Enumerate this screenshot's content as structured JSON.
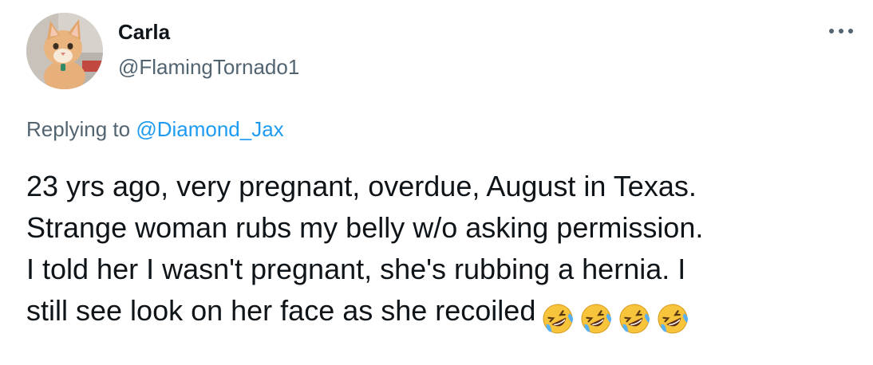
{
  "user": {
    "display_name": "Carla",
    "handle": "@FlamingTornado1"
  },
  "reply": {
    "prefix": "Replying to",
    "mention": "@Diamond_Jax"
  },
  "tweet": {
    "lines": [
      "23 yrs ago, very pregnant, overdue, August in Texas.",
      "Strange woman rubs my belly w/o asking permission.",
      "I told her I wasn't pregnant, she's rubbing a hernia. I",
      "still see look on her face as she recoiled"
    ],
    "emoji": [
      "rolling-on-floor-laughing-icon",
      "rolling-on-floor-laughing-icon",
      "rolling-on-floor-laughing-icon",
      "rolling-on-floor-laughing-icon"
    ]
  },
  "colors": {
    "text": "#0f1419",
    "secondary": "#536471",
    "link": "#1d9bf0",
    "emoji_face": "#f7c43c"
  },
  "icons": {
    "more": "more-horizontal-icon"
  }
}
